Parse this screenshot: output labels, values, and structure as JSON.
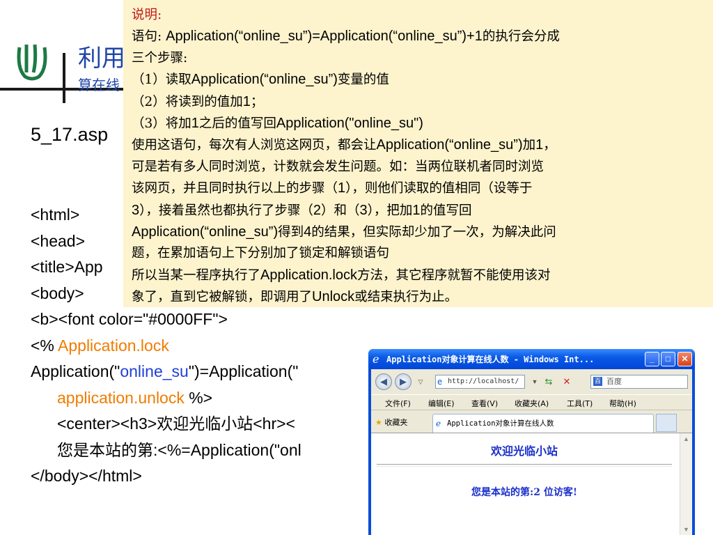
{
  "slide": {
    "title": "利用",
    "subtitle": "算在线",
    "filename": "5_17.asp"
  },
  "code": {
    "line1": "<html>",
    "line2": "<head>",
    "line3": "<title>App",
    "line4": "<body>",
    "line5": "<b><font color=\"#0000FF\">",
    "line6_prefix": "<% ",
    "line6_orange": "Application.lock",
    "line7_a": "Application(\"",
    "line7_blue": "online_su",
    "line7_b": "\")=Application(\"",
    "line8_orange": "application.unlock",
    "line8_suffix": " %>",
    "line9": "<center><h3>欢迎光临小站<hr><",
    "line10": "您是本站的第:<%=Application(\"onl",
    "line11": "</body></html>"
  },
  "note": {
    "heading": "说明:",
    "l1a": "语句:  ",
    "l1b": "Application(“online_su”)=Application(“online_su”)+1",
    "l1c": "的执行会分成",
    "l2": "三个步骤:",
    "l3a": "（1）读取",
    "l3b": "Application(“online_su”)",
    "l3c": "变量的值",
    "l4a": "（2）将读到的值加",
    "l4b": "1",
    "l4c": "；",
    "l5a": "（3）将加",
    "l5b": "1",
    "l5c": "之后的值写回",
    "l5d": "Application(\"online_su\")",
    "l6a": "使用这语句，每次有人浏览这网页，都会让",
    "l6b": "Application(“online_su”)",
    "l6c": "加",
    "l6d": "1",
    "l6e": "，",
    "l7": "可是若有多人同时浏览，计数就会发生问题。如：当两位联机者同时浏览",
    "l8a": "该网页，并且同时执行以上的步骤（",
    "l8b": "1",
    "l8c": "），则他们读取的值相同（设等于",
    "l9a": "3",
    "l9b": "），接着虽然也都执行了步骤（",
    "l9c": "2",
    "l9d": "）和（",
    "l9e": "3",
    "l9f": "），把加",
    "l9g": "1",
    "l9h": "的值写回",
    "l10a": "Application(“online_su”)",
    "l10b": "得到",
    "l10c": "4",
    "l10d": "的结果，但实际却少加了一次，为解决此问",
    "l11": "题，在累加语句上下分别加了锁定和解锁语句",
    "l12a": "所以当某一程序执行了",
    "l12b": "Application.lock",
    "l12c": "方法，其它程序就暂不能使用该对",
    "l13a": "象了，直到它被解锁，即调用了",
    "l13b": "Unlock",
    "l13c": "或结束执行为止。"
  },
  "browser": {
    "title": "Application对象计算在线人数 - Windows Int...",
    "address": "http://localhost/",
    "search_placeholder": "百度",
    "menu": [
      "文件(F)",
      "编辑(E)",
      "查看(V)",
      "收藏夹(A)",
      "工具(T)",
      "帮助(H)"
    ],
    "favorites_label": "收藏夹",
    "tab_title": "Application对象计算在线人数",
    "welcome": "欢迎光临小站",
    "visitor": "您是本站的第:2 位访客!"
  }
}
